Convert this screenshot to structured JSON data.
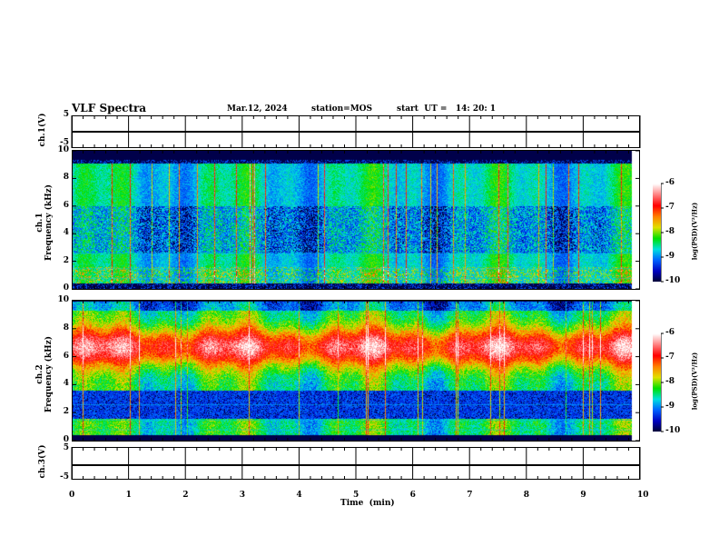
{
  "header": {
    "title": "VLF Spectra",
    "date": "Mar.12, 2024",
    "station": "station=MOS",
    "start": "start  UT =   14: 20: 1"
  },
  "panels": {
    "ch1v": {
      "label": "ch.1(V)",
      "ticks": [
        "5",
        "-5"
      ]
    },
    "spec1": {
      "label": "ch.1\nFrequency (kHz)",
      "label_line1": "ch.1",
      "label_line2": "Frequency (kHz)",
      "ticks": [
        "10",
        "8",
        "6",
        "4",
        "2",
        "0"
      ]
    },
    "spec2": {
      "label_line1": "ch.2",
      "label_line2": "Frequency (kHz)",
      "ticks": [
        "10",
        "8",
        "6",
        "4",
        "2",
        "0"
      ]
    },
    "ch3v": {
      "label": "ch.3(V)",
      "ticks": [
        "5",
        "-5"
      ]
    }
  },
  "colorbar": {
    "label": "log(PSD)(V²/Hz)",
    "ticks": [
      "-6",
      "-7",
      "-8",
      "-9",
      "-10"
    ],
    "range": [
      -10,
      -6
    ],
    "colors": [
      "#000030",
      "#0000c0",
      "#0060ff",
      "#00e0e0",
      "#00e000",
      "#e0e000",
      "#ff8000",
      "#ff0000",
      "#ff8080",
      "#ffffff"
    ]
  },
  "xaxis": {
    "label": "Time  (min)",
    "ticks": [
      "0",
      "1",
      "2",
      "3",
      "4",
      "5",
      "6",
      "7",
      "8",
      "9",
      "10"
    ],
    "range": [
      0,
      10
    ]
  },
  "chart_data": [
    {
      "type": "line",
      "title": "ch.1(V)",
      "ylim": [
        -5,
        5
      ],
      "xlim": [
        0,
        10
      ],
      "description_value": 0
    },
    {
      "type": "heatmap",
      "ylabel": "Frequency (kHz)",
      "ylim": [
        0,
        10
      ],
      "xlim": [
        0,
        9.85
      ],
      "colorbar_range": [
        -10,
        -6
      ]
    },
    {
      "type": "heatmap",
      "ylabel": "Frequency (kHz)",
      "ylim": [
        0,
        10
      ],
      "xlim": [
        0,
        9.85
      ],
      "colorbar_range": [
        -10,
        -6
      ]
    },
    {
      "type": "line",
      "title": "ch.3(V)",
      "ylim": [
        -5,
        5
      ],
      "xlim": [
        0,
        10
      ]
    }
  ]
}
